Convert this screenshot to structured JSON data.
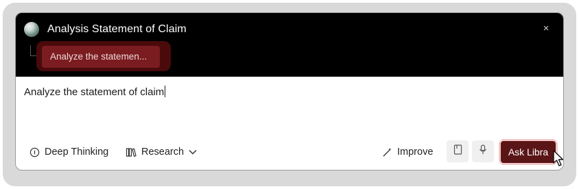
{
  "dialog": {
    "title": "Analysis Statement of Claim",
    "close_label": "×"
  },
  "chip": {
    "label": "Analyze the statemen..."
  },
  "editor": {
    "value": "Analyze the statement of claim"
  },
  "toolbar": {
    "deep_thinking_label": "Deep Thinking",
    "research_label": "Research",
    "improve_label": "Improve",
    "ask_label": "Ask Libra"
  },
  "colors": {
    "header_bg": "#000000",
    "chip_bg": "#7a1c20",
    "ask_button_bg": "#5a1517",
    "ask_glow": "#f3c7c7"
  },
  "icons": {
    "avatar": "gradient-orb-avatar",
    "deep_thinking": "info-circle-icon",
    "research": "books-icon",
    "improve": "magic-pen-icon",
    "dropdown": "chevron-down-icon",
    "attach": "document-icon",
    "mic": "microphone-icon"
  }
}
